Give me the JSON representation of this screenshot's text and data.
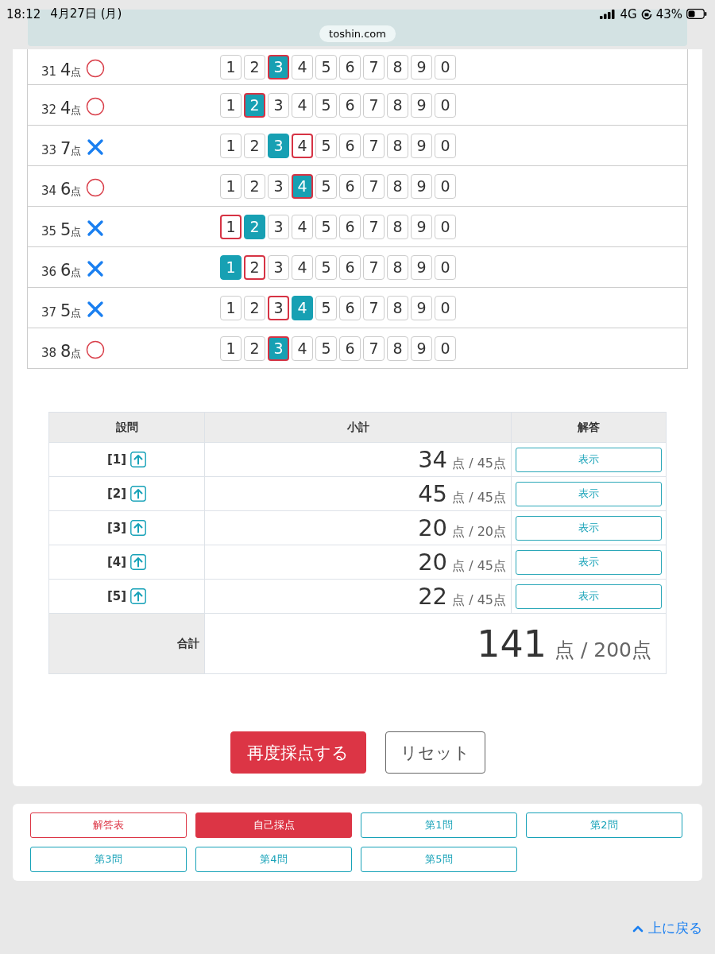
{
  "status_bar": {
    "time": "18:12",
    "date": "4月27日 (月)",
    "network": "4G",
    "battery": "43%"
  },
  "address_bar": {
    "url": "toshin.com"
  },
  "answers": [
    {
      "number": "31",
      "points": "4",
      "unit": "点",
      "kind": "correct",
      "choices": [
        {
          "label": "1",
          "selected": false,
          "answer": false
        },
        {
          "label": "2",
          "selected": false,
          "answer": false
        },
        {
          "label": "3",
          "selected": true,
          "answer": true
        },
        {
          "label": "4",
          "selected": false,
          "answer": false
        },
        {
          "label": "5",
          "selected": false,
          "answer": false
        },
        {
          "label": "6",
          "selected": false,
          "answer": false
        },
        {
          "label": "7",
          "selected": false,
          "answer": false
        },
        {
          "label": "8",
          "selected": false,
          "answer": false
        },
        {
          "label": "9",
          "selected": false,
          "answer": false
        },
        {
          "label": "0",
          "selected": false,
          "answer": false
        }
      ]
    },
    {
      "number": "32",
      "points": "4",
      "unit": "点",
      "kind": "correct",
      "choices": [
        {
          "label": "1",
          "selected": false,
          "answer": false
        },
        {
          "label": "2",
          "selected": true,
          "answer": true
        },
        {
          "label": "3",
          "selected": false,
          "answer": false
        },
        {
          "label": "4",
          "selected": false,
          "answer": false
        },
        {
          "label": "5",
          "selected": false,
          "answer": false
        },
        {
          "label": "6",
          "selected": false,
          "answer": false
        },
        {
          "label": "7",
          "selected": false,
          "answer": false
        },
        {
          "label": "8",
          "selected": false,
          "answer": false
        },
        {
          "label": "9",
          "selected": false,
          "answer": false
        },
        {
          "label": "0",
          "selected": false,
          "answer": false
        }
      ]
    },
    {
      "number": "33",
      "points": "7",
      "unit": "点",
      "kind": "wrong",
      "choices": [
        {
          "label": "1",
          "selected": false,
          "answer": false
        },
        {
          "label": "2",
          "selected": false,
          "answer": false
        },
        {
          "label": "3",
          "selected": true,
          "answer": false
        },
        {
          "label": "4",
          "selected": false,
          "answer": true
        },
        {
          "label": "5",
          "selected": false,
          "answer": false
        },
        {
          "label": "6",
          "selected": false,
          "answer": false
        },
        {
          "label": "7",
          "selected": false,
          "answer": false
        },
        {
          "label": "8",
          "selected": false,
          "answer": false
        },
        {
          "label": "9",
          "selected": false,
          "answer": false
        },
        {
          "label": "0",
          "selected": false,
          "answer": false
        }
      ]
    },
    {
      "number": "34",
      "points": "6",
      "unit": "点",
      "kind": "correct",
      "choices": [
        {
          "label": "1",
          "selected": false,
          "answer": false
        },
        {
          "label": "2",
          "selected": false,
          "answer": false
        },
        {
          "label": "3",
          "selected": false,
          "answer": false
        },
        {
          "label": "4",
          "selected": true,
          "answer": true
        },
        {
          "label": "5",
          "selected": false,
          "answer": false
        },
        {
          "label": "6",
          "selected": false,
          "answer": false
        },
        {
          "label": "7",
          "selected": false,
          "answer": false
        },
        {
          "label": "8",
          "selected": false,
          "answer": false
        },
        {
          "label": "9",
          "selected": false,
          "answer": false
        },
        {
          "label": "0",
          "selected": false,
          "answer": false
        }
      ]
    },
    {
      "number": "35",
      "points": "5",
      "unit": "点",
      "kind": "wrong",
      "choices": [
        {
          "label": "1",
          "selected": false,
          "answer": true
        },
        {
          "label": "2",
          "selected": true,
          "answer": false
        },
        {
          "label": "3",
          "selected": false,
          "answer": false
        },
        {
          "label": "4",
          "selected": false,
          "answer": false
        },
        {
          "label": "5",
          "selected": false,
          "answer": false
        },
        {
          "label": "6",
          "selected": false,
          "answer": false
        },
        {
          "label": "7",
          "selected": false,
          "answer": false
        },
        {
          "label": "8",
          "selected": false,
          "answer": false
        },
        {
          "label": "9",
          "selected": false,
          "answer": false
        },
        {
          "label": "0",
          "selected": false,
          "answer": false
        }
      ]
    },
    {
      "number": "36",
      "points": "6",
      "unit": "点",
      "kind": "wrong",
      "choices": [
        {
          "label": "1",
          "selected": true,
          "answer": false
        },
        {
          "label": "2",
          "selected": false,
          "answer": true
        },
        {
          "label": "3",
          "selected": false,
          "answer": false
        },
        {
          "label": "4",
          "selected": false,
          "answer": false
        },
        {
          "label": "5",
          "selected": false,
          "answer": false
        },
        {
          "label": "6",
          "selected": false,
          "answer": false
        },
        {
          "label": "7",
          "selected": false,
          "answer": false
        },
        {
          "label": "8",
          "selected": false,
          "answer": false
        },
        {
          "label": "9",
          "selected": false,
          "answer": false
        },
        {
          "label": "0",
          "selected": false,
          "answer": false
        }
      ]
    },
    {
      "number": "37",
      "points": "5",
      "unit": "点",
      "kind": "wrong",
      "choices": [
        {
          "label": "1",
          "selected": false,
          "answer": false
        },
        {
          "label": "2",
          "selected": false,
          "answer": false
        },
        {
          "label": "3",
          "selected": false,
          "answer": true
        },
        {
          "label": "4",
          "selected": true,
          "answer": false
        },
        {
          "label": "5",
          "selected": false,
          "answer": false
        },
        {
          "label": "6",
          "selected": false,
          "answer": false
        },
        {
          "label": "7",
          "selected": false,
          "answer": false
        },
        {
          "label": "8",
          "selected": false,
          "answer": false
        },
        {
          "label": "9",
          "selected": false,
          "answer": false
        },
        {
          "label": "0",
          "selected": false,
          "answer": false
        }
      ]
    },
    {
      "number": "38",
      "points": "8",
      "unit": "点",
      "kind": "correct",
      "choices": [
        {
          "label": "1",
          "selected": false,
          "answer": false
        },
        {
          "label": "2",
          "selected": false,
          "answer": false
        },
        {
          "label": "3",
          "selected": true,
          "answer": true
        },
        {
          "label": "4",
          "selected": false,
          "answer": false
        },
        {
          "label": "5",
          "selected": false,
          "answer": false
        },
        {
          "label": "6",
          "selected": false,
          "answer": false
        },
        {
          "label": "7",
          "selected": false,
          "answer": false
        },
        {
          "label": "8",
          "selected": false,
          "answer": false
        },
        {
          "label": "9",
          "selected": false,
          "answer": false
        },
        {
          "label": "0",
          "selected": false,
          "answer": false
        }
      ]
    }
  ],
  "summary": {
    "columns": [
      "設問",
      "小計",
      "解答"
    ],
    "rows": [
      {
        "question": "[1]",
        "score": "34",
        "out_of": "点 / 45点",
        "button": "表示"
      },
      {
        "question": "[2]",
        "score": "45",
        "out_of": "点 / 45点",
        "button": "表示"
      },
      {
        "question": "[3]",
        "score": "20",
        "out_of": "点 / 20点",
        "button": "表示"
      },
      {
        "question": "[4]",
        "score": "20",
        "out_of": "点 / 45点",
        "button": "表示"
      },
      {
        "question": "[5]",
        "score": "22",
        "out_of": "点 / 45点",
        "button": "表示"
      }
    ],
    "total": {
      "label": "合計",
      "score": "141",
      "out_of": "点 / 200点"
    }
  },
  "actions": [
    {
      "label": "再度採点する",
      "kind": "primary"
    },
    {
      "label": "リセット",
      "kind": "secondary"
    }
  ],
  "nav": [
    {
      "label": "解答表",
      "selected": false,
      "color": "#dc3545"
    },
    {
      "label": "自己採点",
      "selected": true,
      "color": "#dc3545"
    },
    {
      "label": "第1問",
      "selected": false,
      "color": "#17a2b8"
    },
    {
      "label": "第2問",
      "selected": false,
      "color": "#17a2b8"
    },
    {
      "label": "第3問",
      "selected": false,
      "color": "#17a2b8"
    },
    {
      "label": "第4問",
      "selected": false,
      "color": "#17a2b8"
    },
    {
      "label": "第5問",
      "selected": false,
      "color": "#17a2b8"
    }
  ],
  "back_to_top": "上に戻る"
}
